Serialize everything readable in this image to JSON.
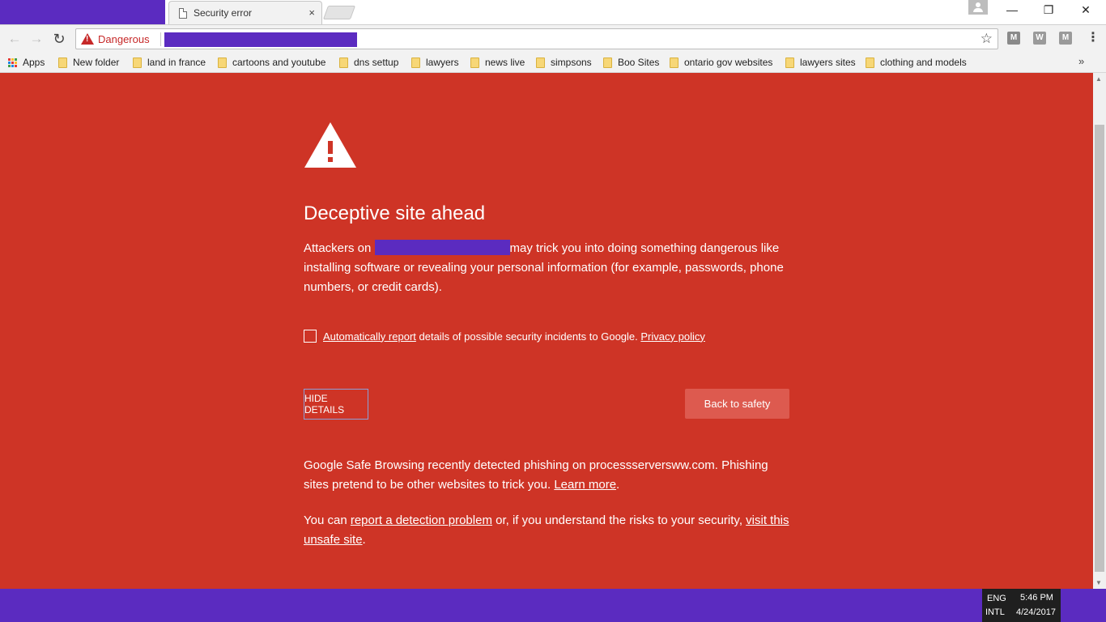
{
  "tabs": [
    {
      "title": "Security error",
      "close_label": "×"
    }
  ],
  "window_controls": {
    "minimize": "—",
    "restore": "❐",
    "close": "✕"
  },
  "toolbar": {
    "back_icon": "←",
    "forward_icon": "→",
    "reload_icon": "↻",
    "security_label": "Dangerous",
    "star_icon": "☆",
    "extensions": [
      "M",
      "W",
      "M"
    ],
    "menu_icon": "⋮"
  },
  "bookmarks": {
    "apps_label": "Apps",
    "items": [
      "New folder",
      "land in france",
      "cartoons and youtube",
      "dns settup",
      "lawyers",
      "news live",
      "simpsons",
      "Boo Sites",
      "ontario gov websites",
      "lawyers sites",
      "clothing and models"
    ],
    "more_icon": "»"
  },
  "interstitial": {
    "heading": "Deceptive site ahead",
    "para1_before": "Attackers on ",
    "para1_after": "may trick you into doing something dangerous like installing software or revealing your personal information (for example, passwords, phone numbers, or credit cards).",
    "report_link": "Automatically report",
    "report_text": " details of possible security incidents to Google. ",
    "privacy_link": "Privacy policy",
    "hide_details_label": "HIDE DETAILS",
    "back_to_safety_label": "Back to safety",
    "para2_text": "Google Safe Browsing recently detected phishing on processserversww.com. Phishing sites pretend to be other websites to trick you. ",
    "learn_more_link": "Learn more",
    "para2_end": ".",
    "para3_start": "You can ",
    "report_problem_link": "report a detection problem",
    "para3_mid": " or, if you understand the risks to your security, ",
    "visit_unsafe_link": "visit this unsafe site",
    "para3_end": "."
  },
  "colors": {
    "danger_red": "#ce3426",
    "button_red": "#dd5a4f",
    "redaction": "#5b2bc0"
  },
  "tray": {
    "lang_top": "ENG",
    "lang_bottom": "INTL",
    "time": "5:46 PM",
    "date": "4/24/2017"
  }
}
